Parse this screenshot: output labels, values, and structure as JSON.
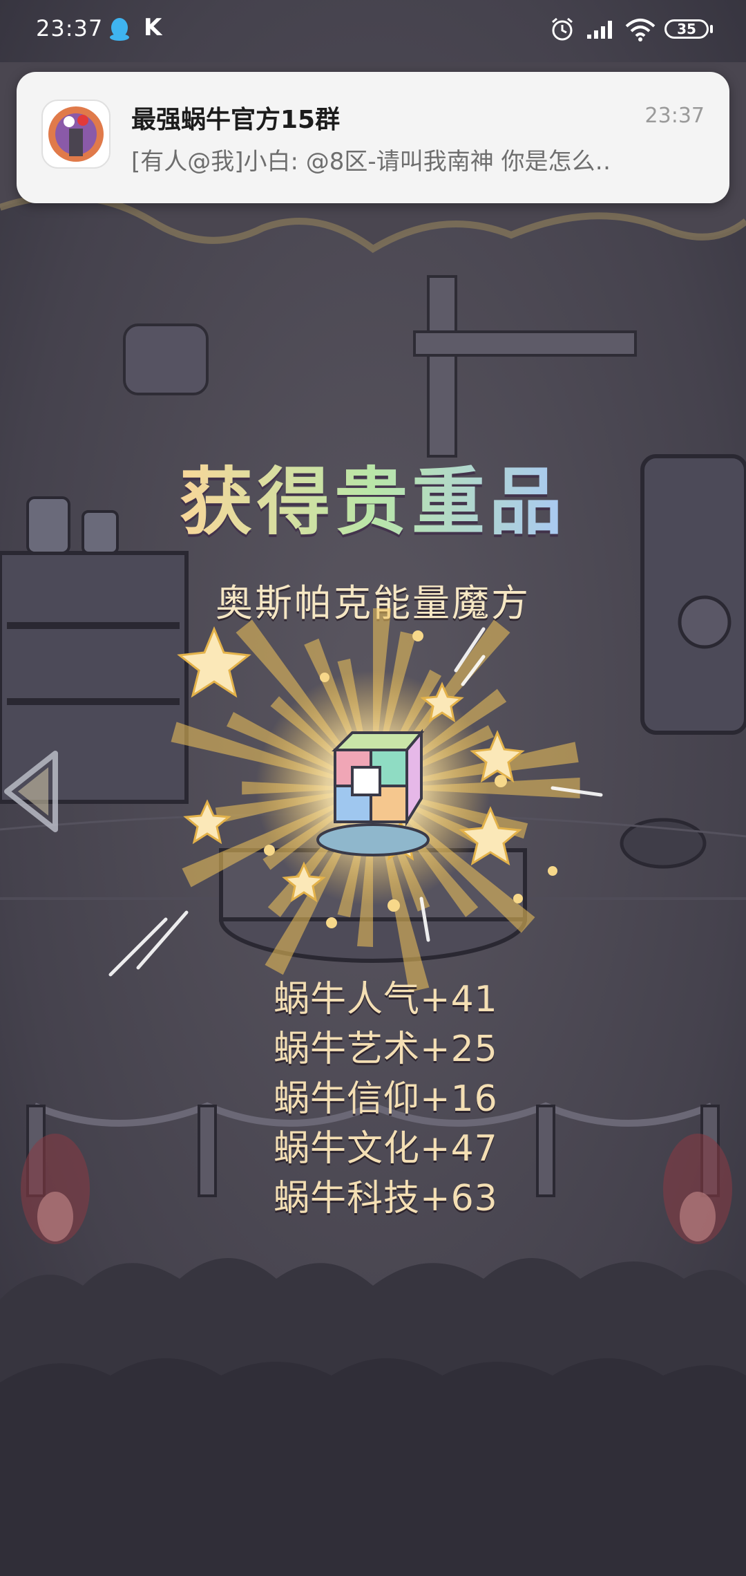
{
  "status_bar": {
    "time": "23:37",
    "k_label": "K",
    "battery": "35"
  },
  "notification": {
    "title": "最强蜗牛官方15群",
    "time": "23:37",
    "message": "[有人@我]小白: @8区-请叫我南神 你是怎么‥"
  },
  "reward": {
    "title": "获得贵重品",
    "item_name": "奥斯帕克能量魔方",
    "stats": [
      "蜗牛人气+41",
      "蜗牛艺术+25",
      "蜗牛信仰+16",
      "蜗牛文化+47",
      "蜗牛科技+63"
    ]
  },
  "colors": {
    "background": "#3b3a45",
    "stat_text": "#f4dfb4",
    "item_name": "#f6e7c4",
    "burst": "#f2c45a"
  },
  "icons": [
    "qq-icon",
    "alarm-icon",
    "signal-icon",
    "wifi-icon",
    "battery-icon",
    "back-arrow-icon",
    "energy-cube-icon"
  ]
}
